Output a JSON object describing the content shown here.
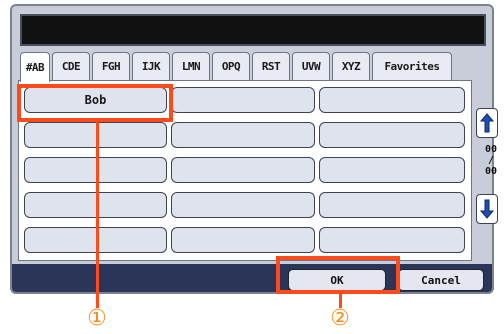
{
  "name_field": {
    "value": ""
  },
  "tabs": [
    {
      "label": "#AB",
      "active": true
    },
    {
      "label": "CDE"
    },
    {
      "label": "FGH"
    },
    {
      "label": "IJK"
    },
    {
      "label": "LMN"
    },
    {
      "label": "OPQ"
    },
    {
      "label": "RST"
    },
    {
      "label": "UVW"
    },
    {
      "label": "XYZ"
    },
    {
      "label": "Favorites"
    }
  ],
  "list": {
    "cells": [
      "Bob",
      "",
      "",
      "",
      "",
      "",
      "",
      "",
      "",
      "",
      "",
      "",
      "",
      "",
      ""
    ]
  },
  "pager": {
    "current": "00",
    "separator": "/",
    "total": "00"
  },
  "actions": {
    "ok_label": "OK",
    "cancel_label": "Cancel"
  },
  "callouts": {
    "first": "①",
    "second": "②"
  },
  "colors": {
    "highlight": "#ff4a1c",
    "callout": "#ff8a1a",
    "bottom_bar": "#2b3558"
  }
}
